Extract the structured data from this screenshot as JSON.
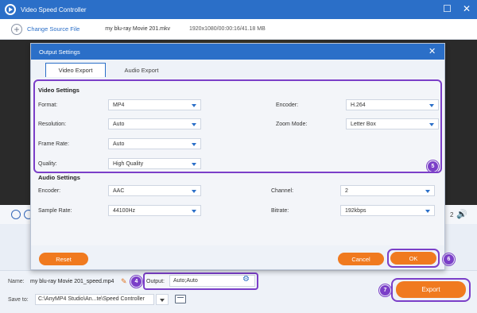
{
  "app": {
    "title": "Video Speed Controller",
    "window_controls": [
      "☐",
      "✕"
    ]
  },
  "source": {
    "change_label": "Change Source File",
    "file_name": "my blu-ray Movie 201.mkv",
    "file_meta": "1920x1080/00:00:16/41.18 MB"
  },
  "player": {
    "volume_number": "2"
  },
  "dialog": {
    "title": "Output Settings",
    "close": "✕",
    "tabs": [
      {
        "label": "Video Export",
        "active": true
      },
      {
        "label": "Audio Export",
        "active": false
      }
    ],
    "video_settings": {
      "heading": "Video Settings",
      "format": {
        "label": "Format:",
        "value": "MP4"
      },
      "encoder": {
        "label": "Encoder:",
        "value": "H.264"
      },
      "resolution": {
        "label": "Resolution:",
        "value": "Auto"
      },
      "zoom_mode": {
        "label": "Zoom Mode:",
        "value": "Letter Box"
      },
      "frame_rate": {
        "label": "Frame Rate:",
        "value": "Auto"
      },
      "quality": {
        "label": "Quality:",
        "value": "High Quality"
      }
    },
    "audio_settings": {
      "heading": "Audio Settings",
      "encoder": {
        "label": "Encoder:",
        "value": "AAC"
      },
      "channel": {
        "label": "Channel:",
        "value": "2"
      },
      "sample_rate": {
        "label": "Sample Rate:",
        "value": "44100Hz"
      },
      "bitrate": {
        "label": "Bitrate:",
        "value": "192kbps"
      }
    },
    "buttons": {
      "reset": "Reset",
      "cancel": "Cancel",
      "ok": "OK"
    }
  },
  "footer": {
    "name_label": "Name:",
    "name_value": "my blu-ray Movie 201_speed.mp4",
    "output_label": "Output:",
    "output_value": "Auto;Auto",
    "save_to_label": "Save to:",
    "save_to_value": "C:\\AnyMP4 Studio\\An...te\\Speed Controller",
    "export_label": "Export"
  },
  "annotations": {
    "badge_4": "4",
    "badge_5": "5",
    "badge_6": "6",
    "badge_7": "7"
  },
  "colors": {
    "accent_blue": "#2b6fc8",
    "highlight_purple": "#7b3fc8",
    "button_orange": "#f07a1f"
  },
  "icons": [
    "app-logo-icon",
    "add-circle-icon",
    "pause-icon",
    "stop-icon",
    "volume-icon",
    "edit-pencil-icon",
    "gear-icon",
    "folder-icon",
    "dropdown-arrow-icon",
    "close-icon"
  ]
}
